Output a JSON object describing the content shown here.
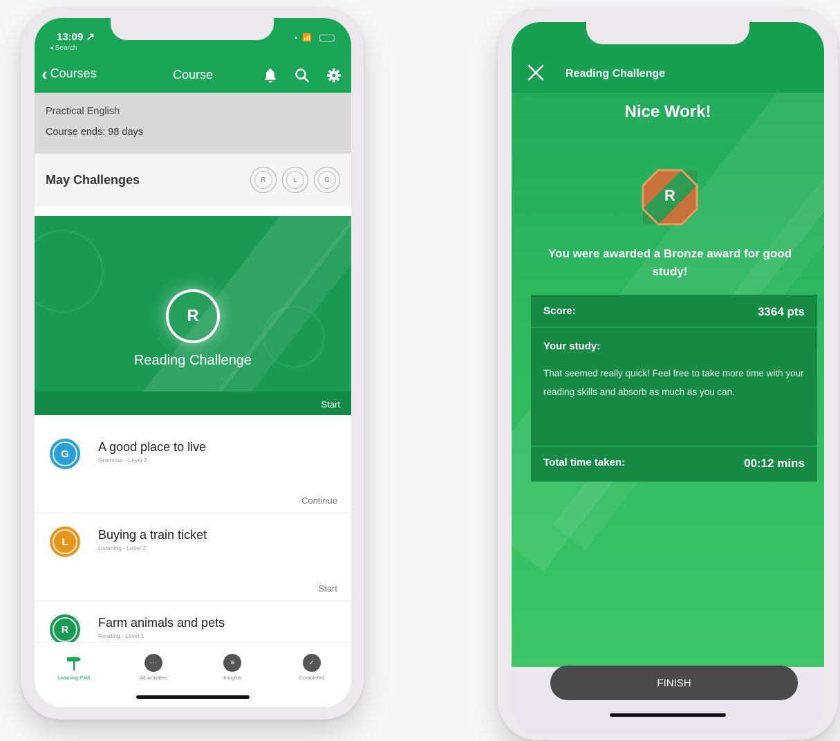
{
  "left_phone": {
    "status": {
      "time": "13:09 ↗",
      "back_app": "◂ Search"
    },
    "nav": {
      "back_label": "Courses",
      "title": "Course"
    },
    "course": {
      "name": "Practical English",
      "ends": "Course ends: 98 days"
    },
    "challenges": {
      "title": "May Challenges",
      "badges": [
        "R",
        "L",
        "G"
      ]
    },
    "hero": {
      "letter": "R",
      "title": "Reading Challenge",
      "action": "Start"
    },
    "lessons": [
      {
        "letter": "G",
        "title": "A good place to live",
        "subtitle": "Grammar - Level 2",
        "action": "Continue",
        "color": "#2a9fd6"
      },
      {
        "letter": "L",
        "title": "Buying a train ticket",
        "subtitle": "Listening - Level 2",
        "action": "Start",
        "color": "#e8951c"
      },
      {
        "letter": "R",
        "title": "Farm animals and pets",
        "subtitle": "Reading - Level 1",
        "action": "",
        "color": "#1a9a54"
      }
    ],
    "tabs": [
      {
        "label": "Learning Path",
        "icon": "signpost-icon"
      },
      {
        "label": "All activities",
        "icon": "activities-icon"
      },
      {
        "label": "Insights",
        "icon": "insights-icon"
      },
      {
        "label": "Completed",
        "icon": "check-icon"
      }
    ]
  },
  "right_phone": {
    "header_title": "Reading Challenge",
    "heading": "Nice Work!",
    "award_letter": "R",
    "award_message": "You were awarded a Bronze award for good study!",
    "score": {
      "label": "Score:",
      "value": "3364 pts"
    },
    "study": {
      "label": "Your study:",
      "text": "That seemed really quick! Feel free to take more time with your reading skills and absorb as much as you can."
    },
    "time": {
      "label": "Total time taken:",
      "value": "00:12 mins"
    },
    "finish_label": "FINISH"
  },
  "colors": {
    "brand_green": "#1aa557",
    "dark_green": "#168a45",
    "bronze": "#c8713c",
    "grammar_blue": "#2a9fd6",
    "listening_orange": "#e8951c"
  }
}
